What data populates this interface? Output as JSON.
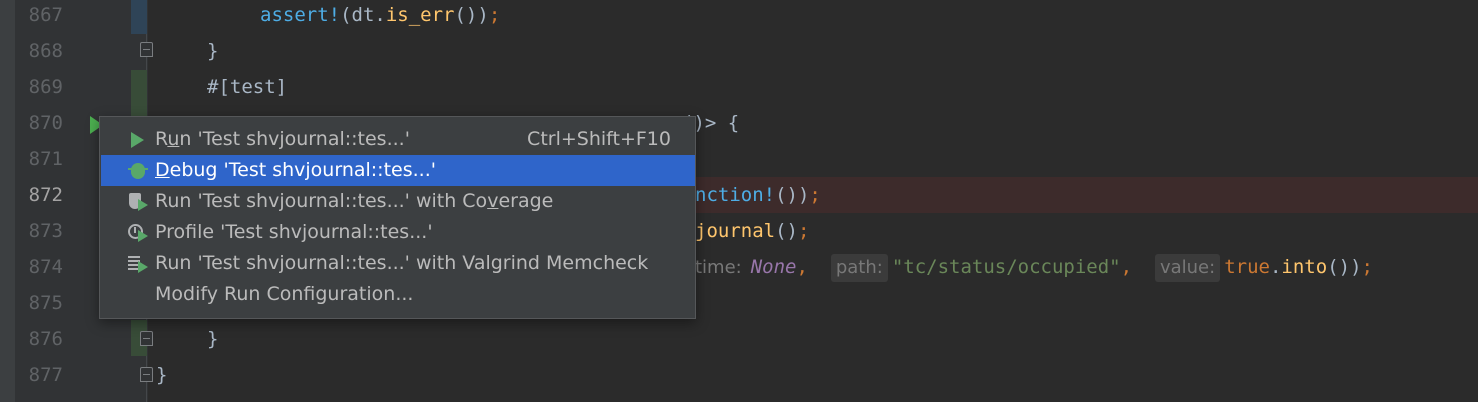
{
  "editor": {
    "lines": [
      {
        "num": "867",
        "code": {
          "macro": "assert!",
          "p1": "(dt.",
          "fn": "is_err",
          "p2": "())",
          "semi": ";"
        }
      },
      {
        "num": "868",
        "code": {
          "text": "}"
        }
      },
      {
        "num": "869",
        "code": {
          "attr": "#[test]"
        }
      },
      {
        "num": "870",
        "code": {
          "tail": "()> {"
        }
      },
      {
        "num": "871",
        "code": {
          "text": ""
        }
      },
      {
        "num": "872",
        "code": {
          "fn_tail": "nction!",
          "rest": "())",
          "semi": ";"
        }
      },
      {
        "num": "873",
        "code": {
          "fn_tail": "journal",
          "rest": "()",
          "semi": ";"
        }
      },
      {
        "num": "874",
        "code": {
          "hint1": "time:",
          "none": "None",
          "comma1": ",",
          "hint2": "path:",
          "str": "\"tc/status/occupied\"",
          "comma2": ",",
          "hint3": "value:",
          "bool": "true",
          "dot": ".",
          "into": "into",
          "rest": "())",
          "semi": ";"
        }
      },
      {
        "num": "875",
        "code": {
          "text": ""
        }
      },
      {
        "num": "876",
        "code": {
          "text": "}"
        }
      },
      {
        "num": "877",
        "code": {
          "text": "}"
        }
      }
    ]
  },
  "context_menu": {
    "items": [
      {
        "pre": "R",
        "u": "u",
        "post": "n 'Test shvjournal::tes...'",
        "shortcut": "Ctrl+Shift+F10",
        "icon": "run-icon"
      },
      {
        "pre": "",
        "u": "D",
        "post": "ebug 'Test shvjournal::tes...'",
        "icon": "debug-icon",
        "selected": true
      },
      {
        "pre": "Run 'Test shvjournal::tes...' with Co",
        "u": "v",
        "post": "erage",
        "icon": "coverage-icon"
      },
      {
        "pre": "Profile 'Test shvjournal::tes...'",
        "u": "",
        "post": "",
        "icon": "profile-icon"
      },
      {
        "pre": "Run 'Test shvjournal::tes...' with Valgrind Memcheck",
        "u": "",
        "post": "",
        "icon": "valgrind-icon"
      },
      {
        "pre": "Modify Run Configuration...",
        "u": "",
        "post": "",
        "icon": ""
      }
    ]
  },
  "colors": {
    "selection": "#2f65ca",
    "error_line": "#3d2b2b",
    "run_green": "#59a869"
  }
}
